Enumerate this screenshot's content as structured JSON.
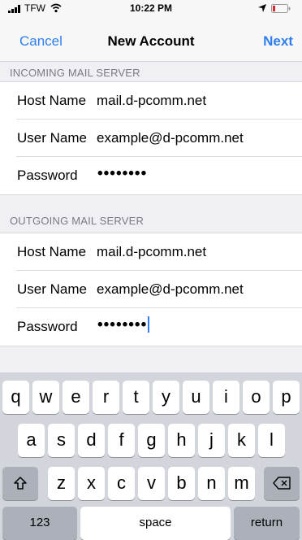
{
  "status_bar": {
    "carrier": "TFW",
    "time": "10:22 PM"
  },
  "nav": {
    "cancel_label": "Cancel",
    "title": "New Account",
    "next_label": "Next"
  },
  "incoming": {
    "header": "INCOMING MAIL SERVER",
    "rows": [
      {
        "label": "Host Name",
        "value": "mail.d-pcomm.net"
      },
      {
        "label": "User Name",
        "value": "example@d-pcomm.net"
      },
      {
        "label": "Password",
        "value": "••••••••"
      }
    ]
  },
  "outgoing": {
    "header": "OUTGOING MAIL SERVER",
    "rows": [
      {
        "label": "Host Name",
        "value": "mail.d-pcomm.net"
      },
      {
        "label": "User Name",
        "value": "example@d-pcomm.net"
      },
      {
        "label": "Password",
        "value": "••••••••"
      }
    ]
  },
  "keyboard": {
    "row1": [
      "q",
      "w",
      "e",
      "r",
      "t",
      "y",
      "u",
      "i",
      "o",
      "p"
    ],
    "row2": [
      "a",
      "s",
      "d",
      "f",
      "g",
      "h",
      "j",
      "k",
      "l"
    ],
    "row3": [
      "z",
      "x",
      "c",
      "v",
      "b",
      "n",
      "m"
    ],
    "numbers_label": "123",
    "space_label": "space",
    "return_label": "return"
  },
  "colors": {
    "accent": "#2f7ff0",
    "background": "#efeff4",
    "keyboard": "#d2d5db"
  },
  "icons": [
    "signal-icon",
    "wifi-icon",
    "location-icon",
    "battery-icon",
    "shift-icon",
    "backspace-icon"
  ]
}
